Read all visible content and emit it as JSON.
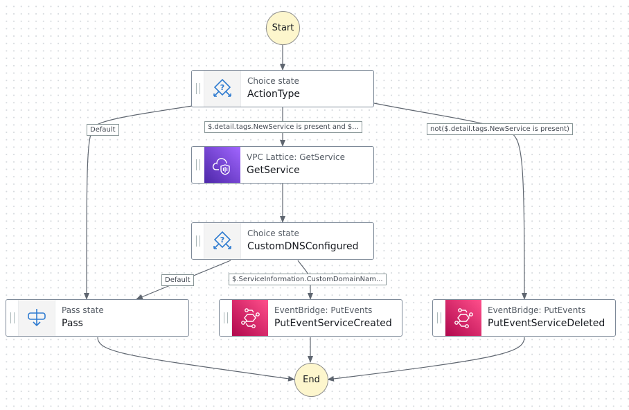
{
  "start": {
    "label": "Start"
  },
  "end": {
    "label": "End"
  },
  "nodes": {
    "action_type": {
      "type": "Choice state",
      "name": "ActionType",
      "icon": "choice-icon"
    },
    "get_service": {
      "type": "VPC Lattice: GetService",
      "name": "GetService",
      "icon": "vpc-lattice-icon",
      "color": "#7b46e0"
    },
    "custom_dns": {
      "type": "Choice state",
      "name": "CustomDNSConfigured",
      "icon": "choice-icon"
    },
    "pass": {
      "type": "Pass state",
      "name": "Pass",
      "icon": "pass-icon"
    },
    "put_created": {
      "type": "EventBridge: PutEvents",
      "name": "PutEventServiceCreated",
      "icon": "eventbridge-icon",
      "color": "#d6336c"
    },
    "put_deleted": {
      "type": "EventBridge: PutEvents",
      "name": "PutEventServiceDeleted",
      "icon": "eventbridge-icon",
      "color": "#d6336c"
    }
  },
  "edge_labels": {
    "action_default": "Default",
    "action_new_service": "$.detail.tags.NewService is present and $...",
    "action_not_new_service": "not($.detail.tags.NewService is present)",
    "dns_default": "Default",
    "dns_custom_domain": "$.ServiceInformation.CustomDomainNam..."
  },
  "colors": {
    "choice_icon": "#2e7bd0",
    "edge": "#5f6670",
    "circle_fill": "#fdf6cd"
  }
}
